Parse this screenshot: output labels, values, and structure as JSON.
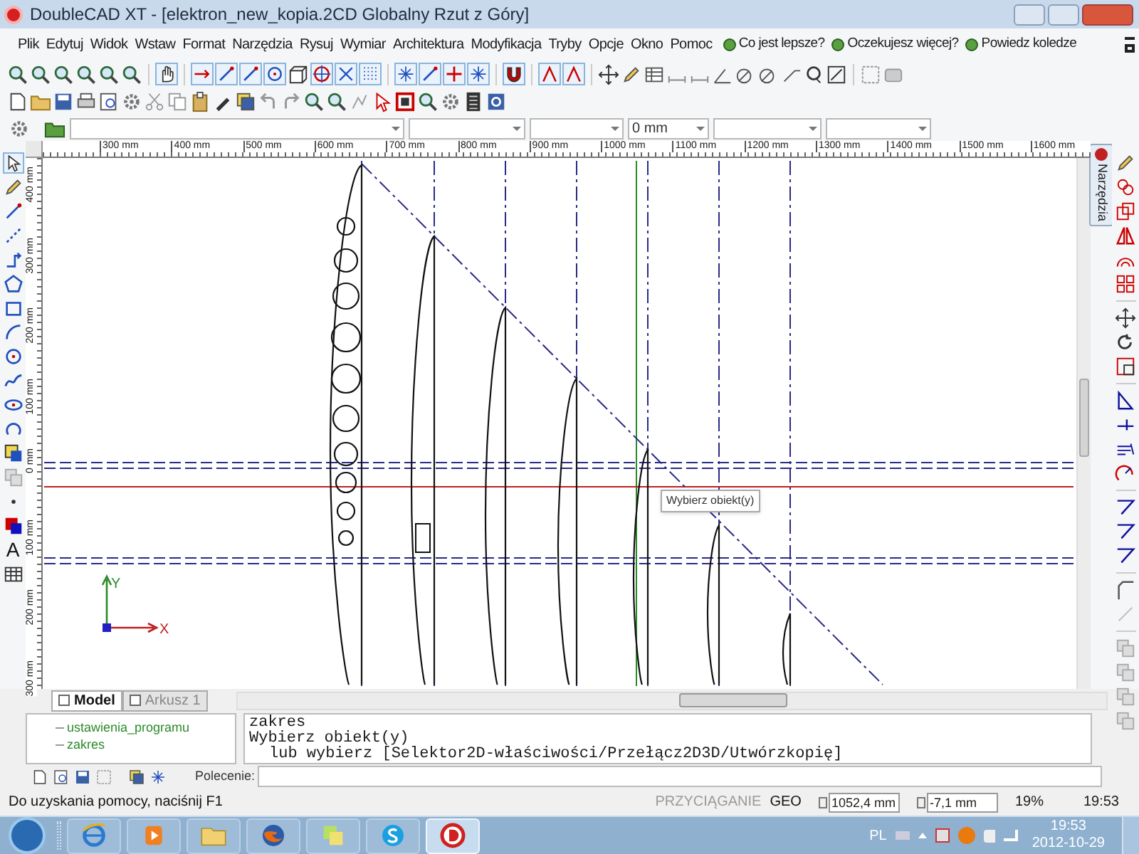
{
  "window": {
    "title": "DoubleCAD XT - [elektron_new_kopia.2CD Globalny Rzut z Góry]"
  },
  "menu": [
    "Plik",
    "Edytuj",
    "Widok",
    "Wstaw",
    "Format",
    "Narzędzia",
    "Rysuj",
    "Wymiar",
    "Architektura",
    "Modyfikacja",
    "Tryby",
    "Opcje",
    "Okno",
    "Pomoc"
  ],
  "menu_links": [
    "Co jest lepsze?",
    "Oczekujesz więcej?",
    "Powiedz koledze"
  ],
  "unit_field": {
    "value": "0 mm"
  },
  "ruler_top": [
    "300 mm",
    "400 mm",
    "500 mm",
    "600 mm",
    "700 mm",
    "800 mm",
    "900 mm",
    "1000 mm",
    "1100 mm",
    "1200 mm",
    "1300 mm",
    "1400 mm",
    "1500 mm",
    "1600 mm"
  ],
  "ruler_left": [
    "400 mm",
    "300 mm",
    "200 mm",
    "100 mm",
    "0 mm",
    "100 mm",
    "200 mm",
    "300 mm"
  ],
  "text_tool": {
    "label": "A"
  },
  "side_tab": {
    "label": "Narzędzia"
  },
  "drawing": {
    "tooltip": "Wybierz obiekt(y)",
    "axis_labels": [
      "Y",
      "X"
    ]
  },
  "sheet_tabs": [
    {
      "label": "Model",
      "selected": true
    },
    {
      "label": "Arkusz 1",
      "selected": false
    }
  ],
  "tree": [
    "ustawienia_programu",
    "zakres"
  ],
  "command_log": [
    {
      "kind": "line",
      "text": "zakres"
    },
    {
      "kind": "line",
      "text": "Wybierz obiekt(y)"
    },
    {
      "kind": "option",
      "text": "lub wybierz [Selektor2D-właściwości/Przełącz2D3D/Utwórzkopię]"
    }
  ],
  "command_input": {
    "label": "Polecenie:"
  },
  "status_bar": {
    "help": "Do uzyskania pomocy, naciśnij F1",
    "snap": {
      "label": "PRZYCIĄGANIE",
      "disabled": true
    },
    "geo": "GEO",
    "x": "1052,4 mm",
    "y": "-7,1 mm",
    "zoom": "19%",
    "time": "19:53"
  },
  "taskbar": {
    "apps": [
      {
        "kind": "browser",
        "selected": false
      },
      {
        "kind": "media",
        "selected": false
      },
      {
        "kind": "folder",
        "selected": false
      },
      {
        "kind": "firefox",
        "selected": false
      },
      {
        "kind": "notes",
        "selected": false
      },
      {
        "kind": "skype",
        "selected": false
      },
      {
        "kind": "cad",
        "selected": true
      }
    ],
    "language": "PL",
    "time": "19:53",
    "date": "2012-10-29"
  }
}
